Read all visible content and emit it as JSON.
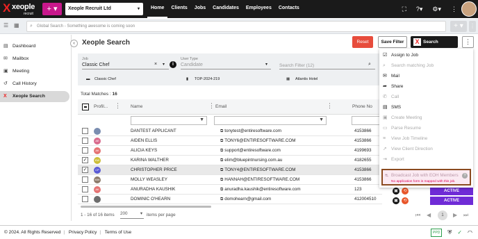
{
  "app": {
    "logo_main": "xeople",
    "logo_sub": "recruit",
    "plus_label": "+ ▾",
    "company": "Xeople Recruit Ltd"
  },
  "nav": [
    "Home",
    "Clients",
    "Jobs",
    "Candidates",
    "Employees",
    "Contacts"
  ],
  "search": {
    "placeholder": "Global Search - Something awesome is coming soon"
  },
  "sidebar": {
    "items": [
      {
        "label": "Dashboard",
        "icon": "clipboard-icon"
      },
      {
        "label": "Mailbox",
        "icon": "mail-icon"
      },
      {
        "label": "Meeting",
        "icon": "calendar-icon"
      },
      {
        "label": "Call History",
        "icon": "history-icon"
      },
      {
        "label": "Xeople Search",
        "icon": "x-icon"
      }
    ]
  },
  "page": {
    "title": "Xeople Search",
    "reset": "Reset",
    "save_filter": "Save Filter",
    "search_xeoplers": "Search Xeoplers"
  },
  "filters": {
    "job_label": "Job",
    "job_value": "Classic Chef",
    "user_type_label": "User Type",
    "user_type_value": "Candidate",
    "search_filter_placeholder": "Search Filter (12)",
    "job_name": "Classic Chef",
    "job_ref": "TOP-2024-219",
    "job_client": "Atlantis Hotel"
  },
  "table": {
    "total_label": "Total Matches : ",
    "total_value": "16",
    "columns": [
      "Profil...",
      "Name",
      "Email",
      "Phone No"
    ],
    "rows": [
      {
        "initials": "",
        "name": "DANTEST APPLICANT",
        "email": "tonytest@entiresoftware.com",
        "phone": "4153866",
        "checked": false,
        "color": "#7a8db0"
      },
      {
        "initials": "AE",
        "name": "AIDEN ELLIS",
        "email": "TONY6@ENTIRESOFTWARE.COM",
        "phone": "4153866",
        "checked": false,
        "color": "#d96b8d"
      },
      {
        "initials": "AK",
        "name": "ALICIA KEYS",
        "email": "support@entiresoftware.com",
        "phone": "4199693",
        "checked": false,
        "color": "#e57373"
      },
      {
        "initials": "KW",
        "name": "KARINA WALTHER",
        "email": "elim@bluepintnursing.com.au",
        "phone": "4182655",
        "checked": true,
        "color": "#cdbf3a"
      },
      {
        "initials": "CP",
        "name": "CHRISTOPHER PRICE",
        "email": "TONY4@ENTIRESOFTWARE.COM",
        "phone": "4153866",
        "checked": true,
        "color": "#5a5ad6"
      },
      {
        "initials": "MW",
        "name": "MOLLY WEASLEY",
        "email": "HANNAH@ENTIRESOFTWARE.COM",
        "phone": "4153866",
        "checked": false,
        "color": "#8d7b6b"
      },
      {
        "initials": "AK",
        "name": "ANURADHA KAUSHIK",
        "email": "anuradha.kaushik@entiresoftware.com",
        "phone": "123",
        "checked": false,
        "color": "#e57373"
      },
      {
        "initials": "",
        "name": "DOMINIC O'HEARN",
        "email": "domohearn@gmail.com",
        "phone": "412004510",
        "checked": false,
        "color": "#6d6d6d"
      }
    ],
    "status": "ACTIVE"
  },
  "pager": {
    "range": "1 - 16 of 16 items",
    "per_page": "200",
    "per_page_label": "items per page",
    "page": "1"
  },
  "menu": {
    "items": [
      {
        "label": "Assign to Job",
        "icon": "checkbox-icon",
        "disabled": false
      },
      {
        "label": "Search matching Job",
        "icon": "search-icon",
        "disabled": true
      },
      {
        "label": "Mail",
        "icon": "mail-icon",
        "disabled": false
      },
      {
        "label": "Share",
        "icon": "share-icon",
        "disabled": false
      },
      {
        "label": "Call",
        "icon": "phone-icon",
        "disabled": true
      },
      {
        "label": "SMS",
        "icon": "sms-icon",
        "disabled": false
      },
      {
        "label": "Create Meeting",
        "icon": "calendar-icon",
        "disabled": true
      },
      {
        "label": "Parse Resume",
        "icon": "document-icon",
        "disabled": true
      },
      {
        "label": "View Job Timeline",
        "icon": "timeline-icon",
        "disabled": true
      },
      {
        "label": "View Client Direction",
        "icon": "direction-icon",
        "disabled": true
      },
      {
        "label": "Export",
        "icon": "export-icon",
        "disabled": true
      }
    ],
    "broadcast_label": "Broadcast Job with EOH Members",
    "broadcast_note": "No application form is mapped with this job."
  },
  "footer": {
    "copyright": "© 2024. All Rights Reserved",
    "privacy": "Privacy Policy",
    "terms": "Terms of Use",
    "badge": "PPD"
  }
}
